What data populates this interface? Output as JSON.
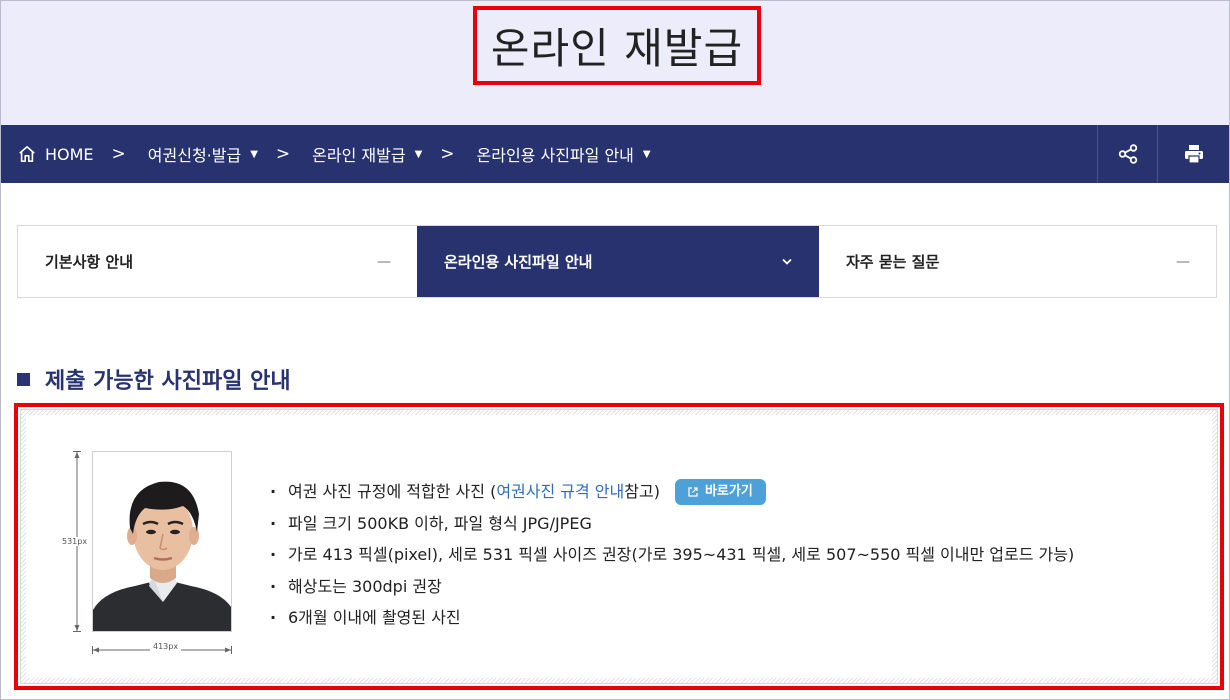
{
  "header": {
    "title": "온라인 재발급"
  },
  "breadcrumb": {
    "home_label": "HOME",
    "items": [
      {
        "label": "여권신청·발급"
      },
      {
        "label": "온라인 재발급"
      },
      {
        "label": "온라인용 사진파일 안내"
      }
    ],
    "separator": ">",
    "dropdown_glyph": "▼"
  },
  "nav_actions": {
    "share_icon": "share-icon",
    "print_icon": "print-icon"
  },
  "tabs": [
    {
      "label": "기본사항 안내",
      "mark": "—",
      "active": false
    },
    {
      "label": "온라인용 사진파일 안내",
      "mark": "⌄",
      "active": true
    },
    {
      "label": "자주 묻는 질문",
      "mark": "—",
      "active": false
    }
  ],
  "section": {
    "title": "제출 가능한 사진파일 안내"
  },
  "photo": {
    "height_label": "531px",
    "width_label": "413px"
  },
  "guidelines": {
    "bullet": "·",
    "item1_pre": "여권 사진 규정에 적합한 사진 (",
    "item1_link": "여권사진 규격 안내",
    "item1_post": " 참고)",
    "go_button": "바로가기",
    "items": [
      "파일 크기 500KB 이하, 파일 형식 JPG/JPEG",
      "가로 413 픽셀(pixel), 세로 531 픽셀 사이즈 권장(가로 395~431 픽셀, 세로 507~550 픽셀 이내만 업로드 가능)",
      "해상도는 300dpi 권장",
      "6개월 이내에 촬영된 사진"
    ]
  },
  "colors": {
    "navy": "#28326f",
    "highlight_red": "#e8000b",
    "banner_bg": "#ececfb",
    "link_blue": "#2f6fbd",
    "button_blue": "#4ea0d8"
  }
}
